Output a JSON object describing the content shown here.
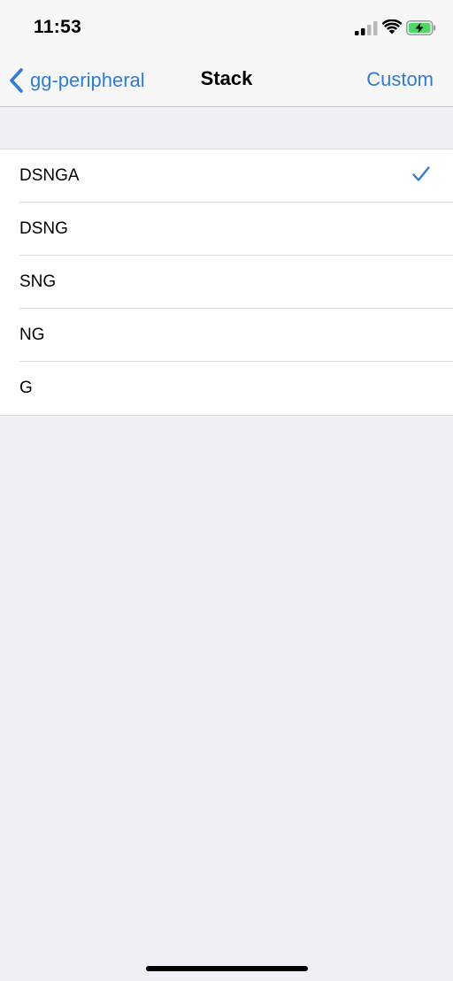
{
  "status_bar": {
    "time": "11:53",
    "signal_icon": "cellular-signal-icon",
    "wifi_icon": "wifi-icon",
    "battery_icon": "battery-charging-icon"
  },
  "nav": {
    "back_label": "gg-peripheral",
    "back_icon": "chevron-left-icon",
    "title": "Stack",
    "right_button_label": "Custom"
  },
  "options": [
    {
      "label": "DSNGA",
      "selected": true
    },
    {
      "label": "DSNG",
      "selected": false
    },
    {
      "label": "SNG",
      "selected": false
    },
    {
      "label": "NG",
      "selected": false
    },
    {
      "label": "G",
      "selected": false
    }
  ],
  "colors": {
    "accent": "#2f7bd9",
    "background": "#f0eff5",
    "battery_fill": "#4cd964"
  }
}
